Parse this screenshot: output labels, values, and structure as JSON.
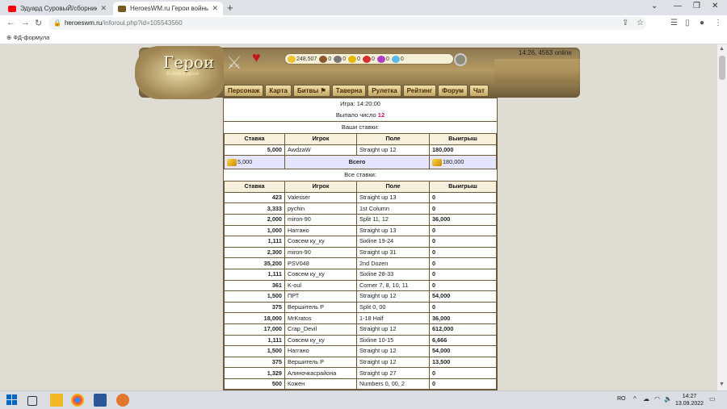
{
  "browser": {
    "tabs": [
      {
        "title": "Эдуард СуровыЙ/сборник - You",
        "close": "✕"
      },
      {
        "title": "HeroesWM.ru Герои войны и де",
        "close": "✕"
      }
    ],
    "new_tab": "+",
    "url_host": "heroeswm.ru",
    "url_path": "/inforoul.php?id=105543560",
    "bookmark": "ФД-формула"
  },
  "game": {
    "logo_title": "Герои",
    "logo_subtitle": "Войны и Денег",
    "resources": [
      "248,507",
      "0",
      "0",
      "0",
      "0",
      "0",
      "0"
    ],
    "online_status": "14:26, 4563 online",
    "menu": [
      "Персонаж",
      "Карта",
      "Битвы",
      "Таверна",
      "Рулетка",
      "Рейтинг",
      "Форум",
      "Чат"
    ]
  },
  "roulette": {
    "game_time": "Игра: 14:20:00",
    "result_prefix": "Выпало число",
    "result_number": "12",
    "your_bets_title": "Ваши ставки:",
    "all_bets_title": "Все ставки:",
    "columns": [
      "Ставка",
      "Игрок",
      "Поле",
      "Выигрыш"
    ],
    "your_bets": [
      {
        "stake": "5,000",
        "player": "AwdzaW",
        "field": "Straight up 12",
        "win": "180,000"
      }
    ],
    "total": {
      "stake": "5,000",
      "label": "Всего",
      "win": "180,000"
    },
    "all_bets": [
      {
        "stake": "423",
        "player": "Valesser",
        "field": "Straight up 13",
        "win": "0"
      },
      {
        "stake": "3,333",
        "player": "pychin",
        "field": "1st Column",
        "win": "0"
      },
      {
        "stake": "2,000",
        "player": "miron-90",
        "field": "Split 11, 12",
        "win": "36,000"
      },
      {
        "stake": "1,000",
        "player": "Наггано",
        "field": "Straight up 13",
        "win": "0"
      },
      {
        "stake": "1,111",
        "player": "Совсем ку_ку",
        "field": "Sixline 19-24",
        "win": "0"
      },
      {
        "stake": "2,300",
        "player": "miron-90",
        "field": "Straight up 31",
        "win": "0"
      },
      {
        "stake": "35,200",
        "player": "PSV048",
        "field": "2nd Dozen",
        "win": "0"
      },
      {
        "stake": "1,111",
        "player": "Совсем ку_ку",
        "field": "Sixline 28-33",
        "win": "0"
      },
      {
        "stake": "361",
        "player": "K-oul",
        "field": "Corner 7, 8, 10, 11",
        "win": "0"
      },
      {
        "stake": "1,500",
        "player": "ПРТ",
        "field": "Straight up 12",
        "win": "54,000"
      },
      {
        "stake": "375",
        "player": "Вершитель Р",
        "field": "Split 0, 00",
        "win": "0"
      },
      {
        "stake": "18,000",
        "player": "MrKratos",
        "field": "1-18 Half",
        "win": "36,000"
      },
      {
        "stake": "17,000",
        "player": "Crap_Devil",
        "field": "Straight up 12",
        "win": "612,000"
      },
      {
        "stake": "1,111",
        "player": "Совсем ку_ку",
        "field": "Sixline 10-15",
        "win": "6,666"
      },
      {
        "stake": "1,500",
        "player": "Наггано",
        "field": "Straight up 12",
        "win": "54,000"
      },
      {
        "stake": "375",
        "player": "Вершитель Р",
        "field": "Straight up 12",
        "win": "13,500"
      },
      {
        "stake": "1,329",
        "player": "Алиночкасрайона",
        "field": "Straight up 27",
        "win": "0"
      },
      {
        "stake": "500",
        "player": "Кожен",
        "field": "Numbers 0, 00, 2",
        "win": "0"
      }
    ]
  },
  "taskbar": {
    "lang": "RO",
    "time": "14:27",
    "date": "13.09.2022"
  }
}
